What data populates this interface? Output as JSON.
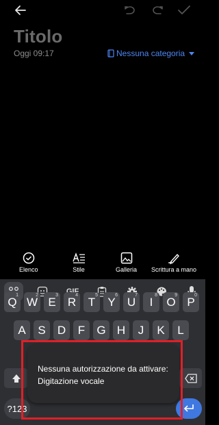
{
  "note": {
    "title": "Titolo",
    "date": "Oggi 09:17",
    "category": "Nessuna categoria"
  },
  "tools": [
    {
      "label": "Elenco",
      "icon": "check-circle-icon"
    },
    {
      "label": "Stile",
      "icon": "text-style-icon"
    },
    {
      "label": "Galleria",
      "icon": "image-icon"
    },
    {
      "label": "Scrittura a mano",
      "icon": "pen-icon"
    }
  ],
  "keyboard": {
    "suggestion_icons": [
      "grid-icon",
      "sticker-icon",
      "gif-icon",
      "clipboard-icon",
      "settings-icon",
      "palette-icon",
      "microphone-icon"
    ],
    "gif_label": "GIF",
    "row1": [
      "Q",
      "W",
      "E",
      "R",
      "T",
      "Y",
      "U",
      "I",
      "O",
      "P"
    ],
    "row1_hints": [
      "1",
      "2",
      "3",
      "4",
      "5",
      "6",
      "7",
      "8",
      "9",
      "0"
    ],
    "row2": [
      "A",
      "S",
      "D",
      "F",
      "G",
      "H",
      "J",
      "K",
      "L"
    ],
    "symbols_label": "?123",
    "enter_icon": "enter-icon"
  },
  "toast": {
    "message": "Nessuna autorizzazione da attivare: Digitazione vocale"
  },
  "colors": {
    "accent": "#4e86f2",
    "highlight": "#e21f26",
    "keyboard_bg": "#2e2f33"
  }
}
